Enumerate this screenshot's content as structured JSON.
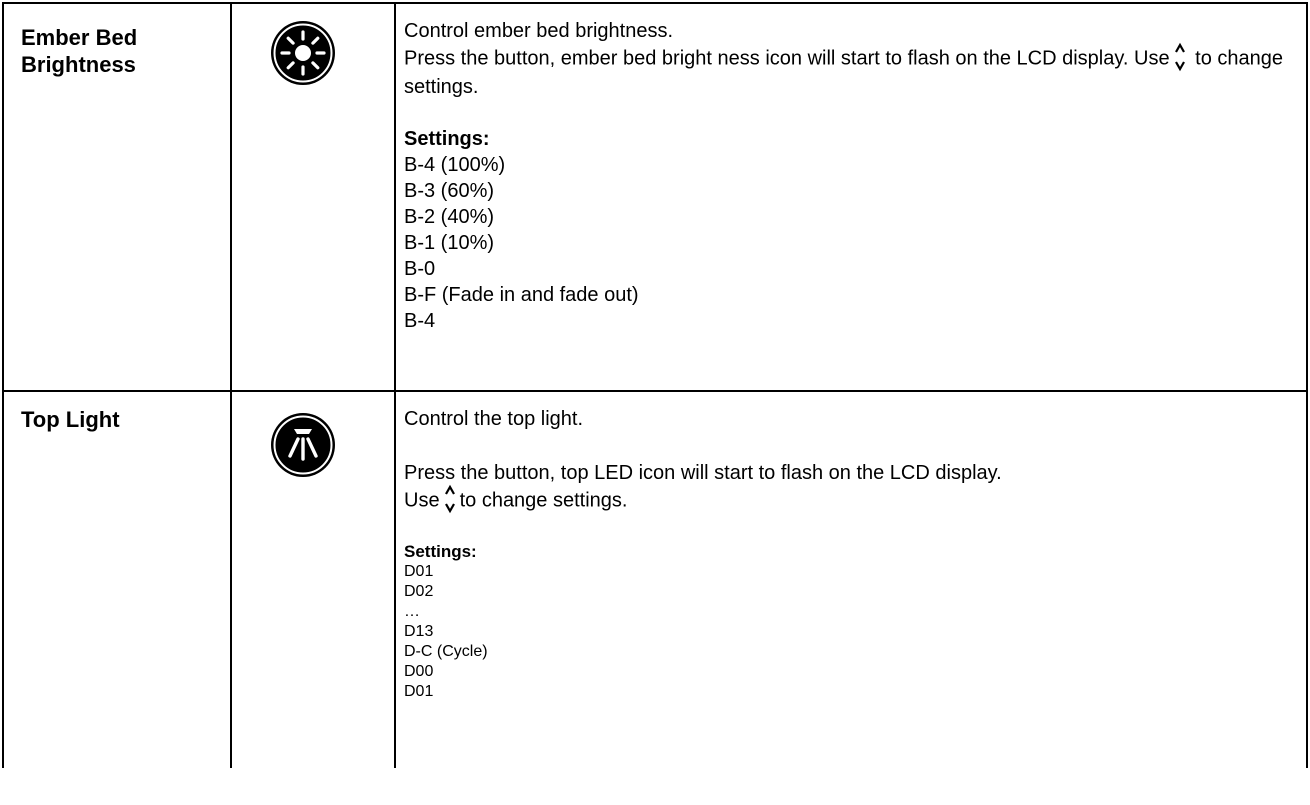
{
  "rows": [
    {
      "feature": "Ember Bed Brightness",
      "icon": "sun-brightness-icon",
      "line1": "Control ember bed brightness.",
      "line2_before_arrow": "Press the button, ember bed bright ness icon will start to flash on the LCD display. Use",
      "line2_after_arrow": "to change settings.",
      "settings_heading": "Settings:",
      "settings": [
        "B-4 (100%)",
        "B-3 (60%)",
        "B-2 (40%)",
        "B-1 (10%)",
        "B-0",
        "B-F (Fade in and fade out)",
        "B-4"
      ]
    },
    {
      "feature": "Top Light",
      "icon": "top-light-icon",
      "line1": "Control the top light.",
      "line2": "Press the button, top LED icon will start to flash on the LCD display.",
      "line3_before_arrow": "Use",
      "line3_after_arrow": "to change settings.",
      "settings_heading": "Settings:",
      "settings": [
        "D01",
        "D02",
        "…",
        "D13",
        "D-C (Cycle)",
        "D00",
        "D01"
      ]
    }
  ],
  "colors": {
    "border": "#000000",
    "icon_fill": "#000000",
    "icon_ring": "#ffffff"
  }
}
